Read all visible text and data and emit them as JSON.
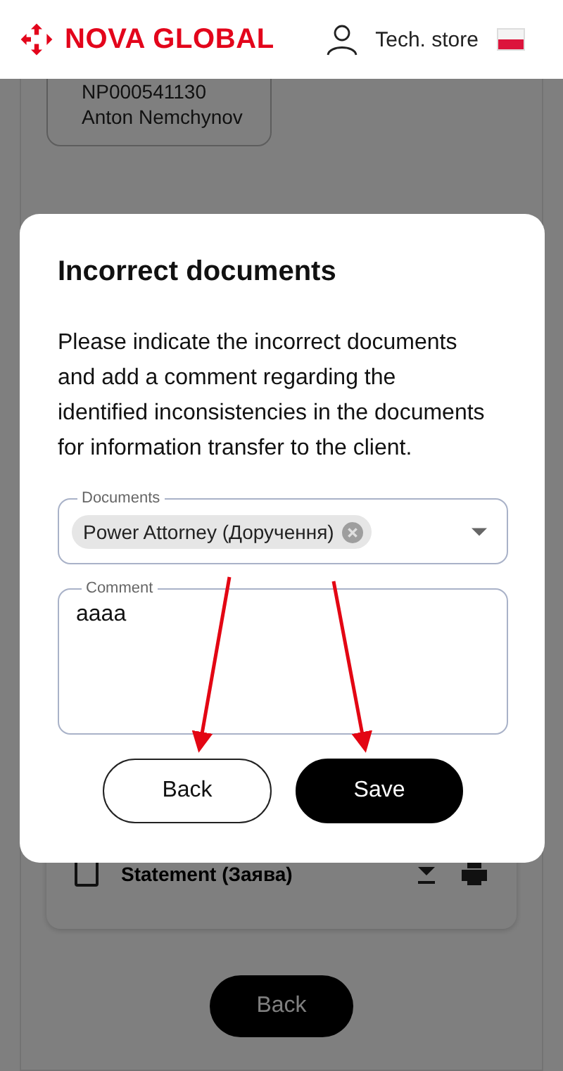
{
  "header": {
    "logo": "NOVA GLOBAL",
    "store": "Tech. store"
  },
  "background": {
    "card_lines": [
      "NP000541130",
      "Anton Nemchynov"
    ],
    "document_row": {
      "label": "Statement (Заява)",
      "checked": false
    },
    "back_button": "Back"
  },
  "dialog": {
    "title": "Incorrect documents",
    "message": "Please indicate the incorrect documents and add a comment regarding the identified inconsistencies in the documents for information transfer to the client.",
    "documents": {
      "label": "Documents",
      "chips": [
        "Power Attorney (Доручення)"
      ]
    },
    "comment": {
      "label": "Comment",
      "value": "aaaa"
    },
    "buttons": [
      {
        "label": "Back",
        "kind": "outline"
      },
      {
        "label": "Save",
        "kind": "filled"
      }
    ]
  }
}
